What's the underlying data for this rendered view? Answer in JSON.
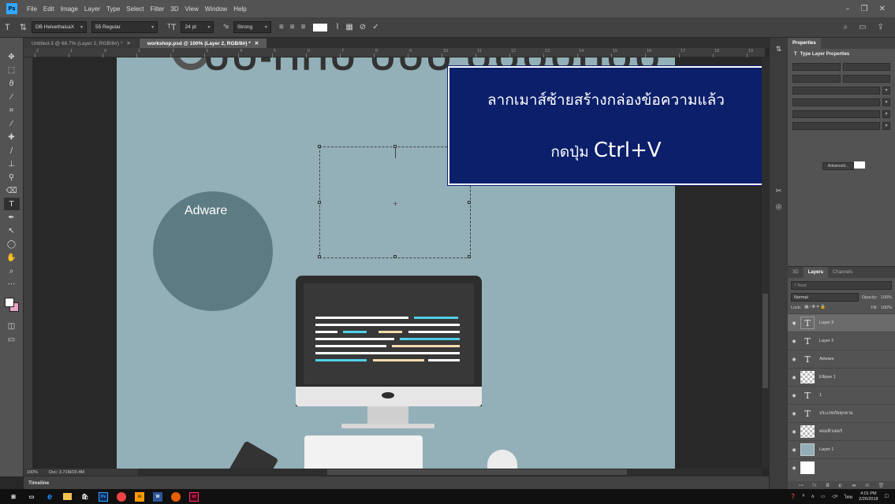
{
  "app": {
    "logo": "Ps"
  },
  "menu": [
    "File",
    "Edit",
    "Image",
    "Layer",
    "Type",
    "Select",
    "Filter",
    "3D",
    "View",
    "Window",
    "Help"
  ],
  "options": {
    "font_family": "DB HelvethaicaX",
    "font_style": "55 Regular",
    "font_size": "24 pt",
    "antialias": "Strong"
  },
  "tabs": [
    {
      "label": "Untitled-3 @ 66.7% (Layer 2, RGB/8#) *",
      "active": false
    },
    {
      "label": "workshop.psd @ 100% (Layer 2, RGB/8#) *",
      "active": true
    }
  ],
  "ruler_ticks": [
    "2",
    "1",
    "0",
    "1",
    "2",
    "3",
    "4",
    "5",
    "6",
    "7",
    "8",
    "9",
    "10",
    "11",
    "12",
    "13",
    "14",
    "15",
    "16",
    "17",
    "18",
    "19"
  ],
  "artboard": {
    "adware_label": "Adware",
    "background": "#93afb7",
    "circle_color": "#5d7b82"
  },
  "overlay": {
    "line1": "ลากเมาส์ซ้ายสร้างกล่องข้อความแล้ว",
    "line2_prefix": "กดปุ่ม",
    "line2_key": "Ctrl+V",
    "bg": "#0b1f6b"
  },
  "status": {
    "zoom": "100%",
    "doc": "Doc: 3.71M/20.4M"
  },
  "timeline_label": "Timeline",
  "properties": {
    "tab": "Properties",
    "header": "Type Layer Properties",
    "advanced_label": "Advanced..."
  },
  "layers_panel": {
    "tabs": [
      "3D",
      "Layers",
      "Channels"
    ],
    "search_placeholder": "Kind",
    "blend_mode": "Normal",
    "opacity_label": "Opacity:",
    "opacity_value": "100%",
    "lock_label": "Lock:",
    "fill_label": "Fill:",
    "fill_value": "100%",
    "layers": [
      {
        "name": "Layer 3",
        "thumb": "T",
        "type": "text",
        "selected": true
      },
      {
        "name": "Layer 2",
        "thumb": "T",
        "type": "text",
        "selected": false
      },
      {
        "name": "Adware",
        "thumb": "T",
        "type": "text",
        "selected": false
      },
      {
        "name": "Ellipse 1",
        "thumb": "",
        "type": "checker",
        "selected": false
      },
      {
        "name": "1",
        "thumb": "T",
        "type": "text",
        "selected": false
      },
      {
        "name": "ประเภทภัยคุกคาม",
        "thumb": "T",
        "type": "text",
        "selected": false
      },
      {
        "name": "คอมพิวเตอร์",
        "thumb": "",
        "type": "checker",
        "selected": false
      },
      {
        "name": "Layer 1",
        "thumb": "",
        "type": "solid",
        "selected": false
      },
      {
        "name": "",
        "thumb": "",
        "type": "white",
        "selected": false
      }
    ]
  },
  "taskbar": {
    "time": "4:01 PM",
    "date": "2/26/2018",
    "lang": "ไทย"
  },
  "colors": {
    "accent": "#31a8ff",
    "overlay": "#0b1f6b",
    "code_blue": "#4fd0e8",
    "code_cream": "#f4dcae"
  }
}
